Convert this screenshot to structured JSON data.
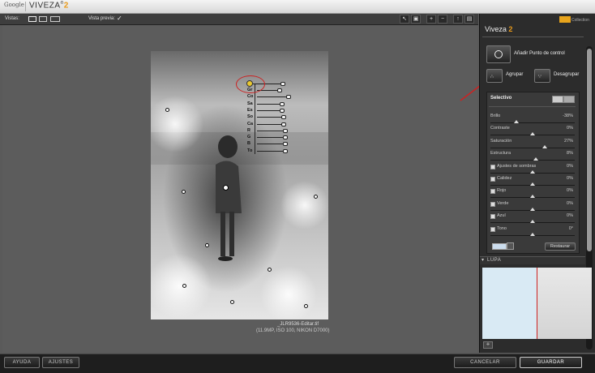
{
  "titlebar": {
    "brand": "Google",
    "app": "VIVEZA",
    "version": "2"
  },
  "toolbar": {
    "views_label": "Vistas:",
    "preview_label": "Vista previa:",
    "preview_check": "✓",
    "tools": [
      "hand-tool",
      "crop-tool",
      "zoom-in-tool",
      "zoom-out-tool",
      "info-tool",
      "export-tool"
    ]
  },
  "image": {
    "filename": "_JLR9536-Editar.tif",
    "details": "(11.9MP, ISO 100, NIKON D7000)"
  },
  "control_point": {
    "labels": [
      "Gr",
      "Co",
      "Sa",
      "Es",
      "So",
      "Ca",
      "R",
      "G",
      "B",
      "To"
    ],
    "levels": [
      0.55,
      0.78,
      0.6,
      0.6,
      0.65,
      0.65,
      0.7,
      0.7,
      0.7,
      0.7
    ],
    "size_level": 0.75
  },
  "panel": {
    "title": "Viveza",
    "title_num": "2",
    "collection": "Collection",
    "add_cp_label": "Añadir Punto de control",
    "group_label": "Agrupar",
    "ungroup_label": "Desagrupar",
    "selective_title": "Selectivo",
    "sliders": [
      {
        "name": "Brillo",
        "value": "-38%",
        "check": false,
        "pos": 0.31
      },
      {
        "name": "Contraste",
        "value": "0%",
        "check": false,
        "pos": 0.5
      },
      {
        "name": "Saturación",
        "value": "27%",
        "check": false,
        "pos": 0.64
      },
      {
        "name": "Estructura",
        "value": "8%",
        "check": false,
        "pos": 0.54
      },
      {
        "name": "Ajustes de sombras",
        "value": "0%",
        "check": true,
        "pos": 0.5
      },
      {
        "name": "Calidez",
        "value": "0%",
        "check": true,
        "pos": 0.5
      },
      {
        "name": "Rojo",
        "value": "0%",
        "check": true,
        "pos": 0.5
      },
      {
        "name": "Verde",
        "value": "0%",
        "check": true,
        "pos": 0.5
      },
      {
        "name": "Azul",
        "value": "0%",
        "check": true,
        "pos": 0.5
      },
      {
        "name": "Tono",
        "value": "0°",
        "check": true,
        "pos": 0.5
      }
    ],
    "restore_label": "Restaurar",
    "lupa_label": "LUPA"
  },
  "bottom": {
    "help": "AYUDA",
    "settings": "AJUSTES",
    "cancel": "CANCELAR",
    "save": "GUARDAR"
  },
  "colors": {
    "accent": "#e89a1a",
    "annotation": "#cc2222"
  }
}
